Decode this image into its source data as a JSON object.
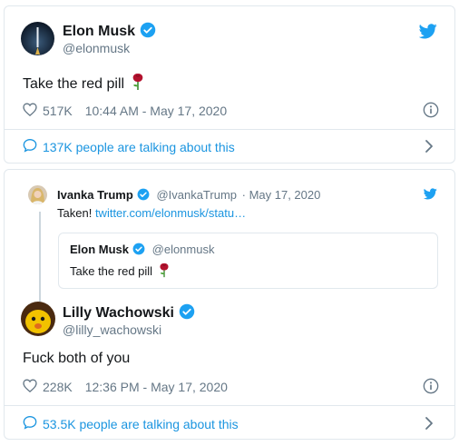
{
  "tweet1": {
    "name": "Elon Musk",
    "handle": "@elonmusk",
    "text": "Take the red pill",
    "likes": "517K",
    "time": "10:44 AM - May 17, 2020",
    "talking": "137K people are talking about this"
  },
  "tweet2": {
    "reply": {
      "name": "Ivanka Trump",
      "handle": "@IvankaTrump",
      "date": "· May 17, 2020",
      "text": "Taken!",
      "link": "twitter.com/elonmusk/statu…"
    },
    "quote": {
      "name": "Elon Musk",
      "handle": "@elonmusk",
      "text": "Take the red pill"
    },
    "name": "Lilly Wachowski",
    "handle": "@lilly_wachowski",
    "text": "Fuck both of you",
    "likes": "228K",
    "time": "12:36 PM - May 17, 2020",
    "talking": "53.5K people are talking about this"
  },
  "colors": {
    "accent": "#1da1f2",
    "link": "#1b95e0",
    "muted": "#657786",
    "rose": "#b3122e"
  },
  "icons": [
    "rocket-avatar",
    "verified-icon",
    "twitter-bird-icon",
    "heart-icon",
    "info-icon",
    "comment-icon",
    "chevron-right-icon",
    "rose-emoji"
  ]
}
